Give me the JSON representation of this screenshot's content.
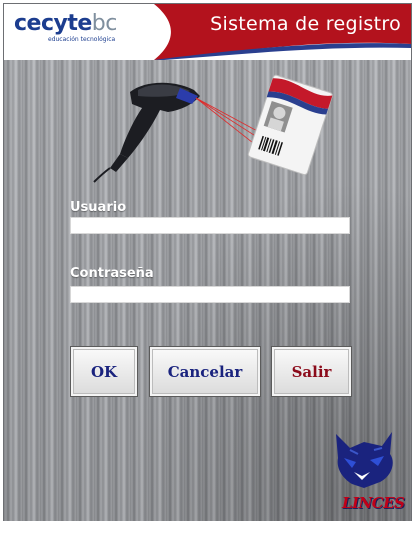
{
  "header": {
    "logo_text": "cecyte",
    "logo_suffix": "bc",
    "logo_tagline": "educación tecnológica",
    "title": "Sistema de registro"
  },
  "form": {
    "username_label": "Usuario",
    "username_value": "",
    "password_label": "Contraseña",
    "password_value": ""
  },
  "buttons": {
    "ok": "OK",
    "cancel": "Cancelar",
    "exit": "Salir"
  },
  "mascot": {
    "text": "LINCES"
  },
  "colors": {
    "header_red": "#b3121d",
    "logo_blue": "#1c3d8f",
    "button_blue_text": "#1a237e",
    "button_red_text": "#8b0a1a"
  },
  "icons": {
    "scanner": "barcode-scanner-icon",
    "id_card": "id-card-icon",
    "mascot": "lynx-mascot-icon"
  }
}
